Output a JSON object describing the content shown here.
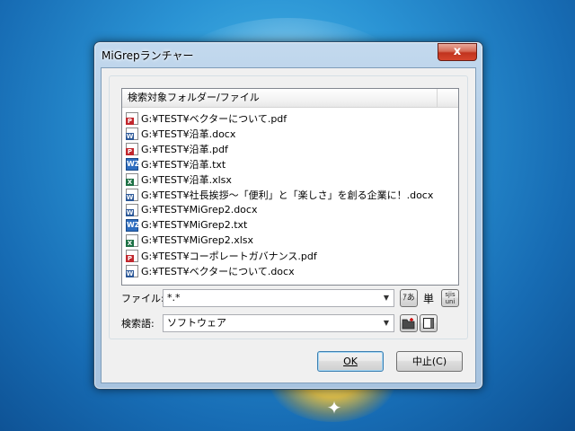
{
  "window": {
    "title": "MiGrepランチャー",
    "close_glyph": "x"
  },
  "list": {
    "header": "検索対象フォルダー/ファイル",
    "items": [
      {
        "text": "G:¥TEST¥ベクターについて.pdf",
        "icon": "pdf-file-icon",
        "badge": "P"
      },
      {
        "text": "G:¥TEST¥沿革.docx",
        "icon": "word-file-icon",
        "badge": "W"
      },
      {
        "text": "G:¥TEST¥沿革.pdf",
        "icon": "pdf-file-icon",
        "badge": "P"
      },
      {
        "text": "G:¥TEST¥沿革.txt",
        "icon": "text-file-icon",
        "badge": "WZ"
      },
      {
        "text": "G:¥TEST¥沿革.xlsx",
        "icon": "excel-file-icon",
        "badge": "X"
      },
      {
        "text": "G:¥TEST¥社長挨拶～「便利」と「楽しさ」を創る企業に！.docx",
        "icon": "word-file-icon",
        "badge": "W"
      },
      {
        "text": "G:¥TEST¥MiGrep2.docx",
        "icon": "word-file-icon",
        "badge": "W"
      },
      {
        "text": "G:¥TEST¥MiGrep2.txt",
        "icon": "text-file-icon",
        "badge": "WZ"
      },
      {
        "text": "G:¥TEST¥MiGrep2.xlsx",
        "icon": "excel-file-icon",
        "badge": "X"
      },
      {
        "text": "G:¥TEST¥コーポレートガバナンス.pdf",
        "icon": "pdf-file-icon",
        "badge": "P"
      },
      {
        "text": "G:¥TEST¥ベクターについて.docx",
        "icon": "word-file-icon",
        "badge": "W"
      }
    ]
  },
  "file_filter": {
    "label": "ファイル:",
    "value": "*.*",
    "kana_button": "ｱあ",
    "word_char": "単",
    "encoding_button": "sjis\nuni"
  },
  "search_term": {
    "label": "検索語:",
    "value": "ソフトウェア"
  },
  "buttons": {
    "ok_label": "OK",
    "cancel_label": "中止(C)"
  }
}
